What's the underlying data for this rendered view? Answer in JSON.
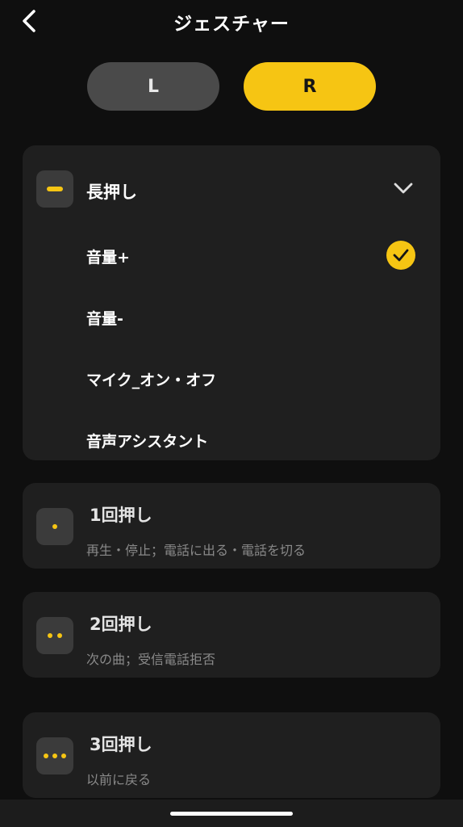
{
  "header": {
    "title": "ジェスチャー",
    "back_icon": "chevron-left-icon"
  },
  "segments": {
    "left_label": "L",
    "right_label": "R",
    "selected": "R"
  },
  "colors": {
    "accent": "#f6c513",
    "background": "#0f0f0f",
    "card": "#1f1f1f",
    "segment_inactive": "#4a4a4a",
    "subtext": "#8a8a8a"
  },
  "gestures": {
    "long_press": {
      "title": "長押し",
      "icon": "dash-icon",
      "expanded": true,
      "options": [
        {
          "label": "音量+",
          "selected": true
        },
        {
          "label": "音量-",
          "selected": false
        },
        {
          "label": "マイク_オン・オフ",
          "selected": false
        },
        {
          "label": "音声アシスタント",
          "selected": false
        }
      ]
    },
    "single_press": {
      "title": "1回押し",
      "icon": "one-dot-icon",
      "subtitle": "再生・停止；電話に出る・電話を切る"
    },
    "double_press": {
      "title": "2回押し",
      "icon": "two-dots-icon",
      "subtitle": "次の曲；受信電話拒否"
    },
    "triple_press": {
      "title": "3回押し",
      "icon": "three-dots-icon",
      "subtitle": "以前に戻る"
    }
  }
}
